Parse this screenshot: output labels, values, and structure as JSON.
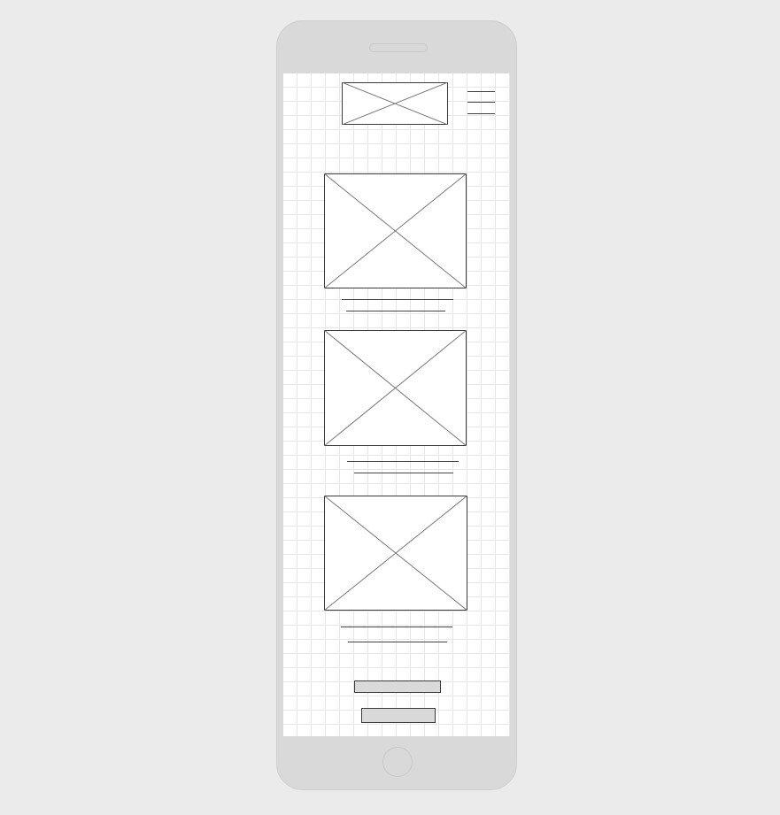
{
  "colors": {
    "background": "#ebebeb",
    "device": "#d9d9d9",
    "screen": "#ffffff",
    "grid": "#e6e6e6",
    "stroke": "#3a3a3a"
  },
  "header": {
    "logo_icon": "image-placeholder-icon",
    "menu_icon": "hamburger-menu-icon"
  },
  "content": {
    "cards": [
      {
        "image_icon": "image-placeholder-icon"
      },
      {
        "image_icon": "image-placeholder-icon"
      },
      {
        "image_icon": "image-placeholder-icon"
      }
    ]
  },
  "buttons": [
    "primary",
    "secondary"
  ]
}
